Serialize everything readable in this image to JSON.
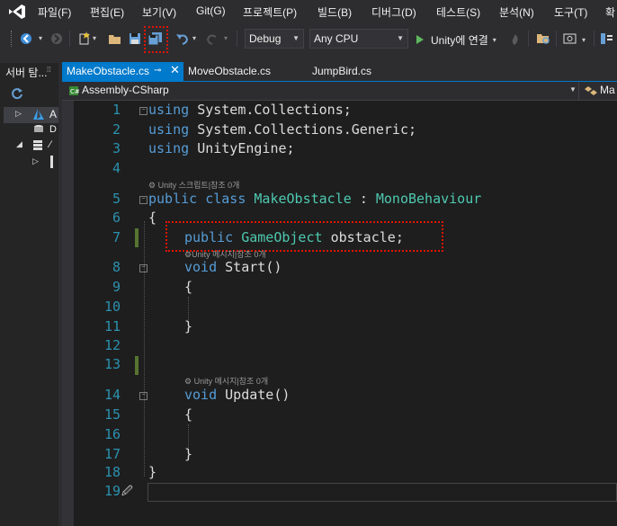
{
  "menu": [
    "파일(F)",
    "편집(E)",
    "보기(V)",
    "Git(G)",
    "프로젝트(P)",
    "빌드(B)",
    "디버그(D)",
    "테스트(S)",
    "분석(N)",
    "도구(T)",
    "확"
  ],
  "toolbar": {
    "config": "Debug",
    "platform": "Any CPU",
    "run_label": "Unity에 연결"
  },
  "left_panel": {
    "title": "서버 탐..."
  },
  "tabs": [
    {
      "label": "MakeObstacle.cs",
      "active": true
    },
    {
      "label": "MoveObstacle.cs",
      "active": false
    },
    {
      "label": "JumpBird.cs",
      "active": false
    }
  ],
  "navbar": {
    "project": "Assembly-CSharp",
    "right": "Ma"
  },
  "code_lens": {
    "class_lens": "Unity 스크립트|참조 0개",
    "method_lens": "Unity 메시지|참조 0개",
    "field_lens": "Unity 메시지|참조 0개"
  },
  "lines": [
    {
      "n": "1",
      "t": "using System.Collections;"
    },
    {
      "n": "2",
      "t": "using System.Collections.Generic;"
    },
    {
      "n": "3",
      "t": "using UnityEngine;"
    },
    {
      "n": "4",
      "t": ""
    },
    {
      "n": "5",
      "t": "public class MakeObstacle : MonoBehaviour"
    },
    {
      "n": "6",
      "t": "{"
    },
    {
      "n": "7",
      "t": "public GameObject obstacle;"
    },
    {
      "n": "8",
      "t": "void Start()"
    },
    {
      "n": "9",
      "t": "{"
    },
    {
      "n": "10",
      "t": ""
    },
    {
      "n": "11",
      "t": "}"
    },
    {
      "n": "12",
      "t": ""
    },
    {
      "n": "13",
      "t": ""
    },
    {
      "n": "14",
      "t": "void Update()"
    },
    {
      "n": "15",
      "t": "{"
    },
    {
      "n": "16",
      "t": ""
    },
    {
      "n": "17",
      "t": "}"
    },
    {
      "n": "18",
      "t": "}"
    },
    {
      "n": "19",
      "t": ""
    }
  ],
  "colors": {
    "keyword": "#569cd6",
    "type": "#4ec9b0",
    "accent": "#007acc",
    "highlight": "#e51400"
  }
}
